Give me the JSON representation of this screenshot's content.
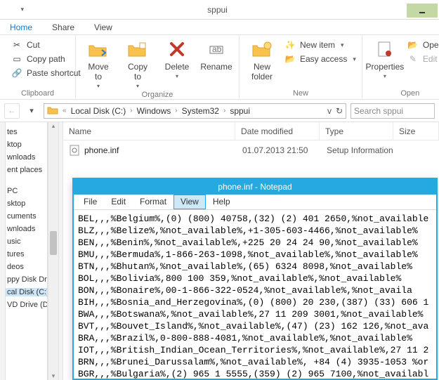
{
  "window": {
    "title": "sppui"
  },
  "tabs": {
    "home": "Home",
    "share": "Share",
    "view": "View"
  },
  "ribbon": {
    "clipboard": {
      "label": "Clipboard",
      "cut": "Cut",
      "copy_path": "Copy path",
      "paste_shortcut": "Paste shortcut"
    },
    "organize": {
      "label": "Organize",
      "move_to": "Move\nto",
      "copy_to": "Copy\nto",
      "delete": "Delete",
      "rename": "Rename"
    },
    "new": {
      "label": "New",
      "new_folder": "New\nfolder",
      "new_item": "New item",
      "easy_access": "Easy access"
    },
    "open": {
      "label": "Open",
      "properties": "Properties",
      "open": "Open",
      "edit": "Edit"
    }
  },
  "address": {
    "segs": [
      "Local Disk (C:)",
      "Windows",
      "System32",
      "sppui"
    ],
    "search_placeholder": "Search sppui"
  },
  "navpane": {
    "items": [
      "tes",
      "ktop",
      "wnloads",
      "ent places",
      "",
      "",
      "PC",
      "sktop",
      "cuments",
      "wnloads",
      "usic",
      "tures",
      "deos",
      "ppy Disk Dri",
      "cal Disk (C:)",
      "VD Drive (D:)"
    ],
    "selected_index": 14
  },
  "columns": {
    "name": "Name",
    "date": "Date modified",
    "type": "Type",
    "size": "Size"
  },
  "file": {
    "name": "phone.inf",
    "date": "01.07.2013 21:50",
    "type": "Setup Information"
  },
  "notepad": {
    "title": "phone.inf - Notepad",
    "menu": {
      "file": "File",
      "edit": "Edit",
      "format": "Format",
      "view": "View",
      "help": "Help"
    },
    "lines": [
      "BEL,,,%Belgium%,(0) (800) 40758,(32) (2) 401 2650,%not_available",
      "BLZ,,,%Belize%,%not_available%,+1-305-603-4466,%not_available%",
      "BEN,,,%Benin%,%not_available%,+225 20 24 24 90,%not_available%",
      "BMU,,,%Bermuda%,1-866-263-1098,%not_available%,%not_available%",
      "BTN,,,%Bhutan%,%not_available%,(65) 6324 8098,%not_available%",
      "BOL,,,%Bolivia%,800 100 359,%not_available%,%not_available%",
      "BON,,,%Bonaire%,00-1-866-322-0524,%not_available%,%not_availa",
      "BIH,,,%Bosnia_and_Herzegovina%,(0) (800) 20 230,(387) (33) 606 1",
      "BWA,,,%Botswana%,%not_available%,27 11 209 3001,%not_available%",
      "BVT,,,%Bouvet_Island%,%not_available%,(47) (23) 162 126,%not_ava",
      "BRA,,,%Brazil%,0-800-888-4081,%not_available%,%not_available%",
      "IOT,,,%British_Indian_Ocean_Territories%,%not_available%,27 11 2",
      "BRN,,,%Brunei_Darussalam%,%not_available%, +84 (4) 3935-1053 %or",
      "BGR,,,%Bulgaria%,(2) 965 1 5555,(359) (2) 965 7100,%not_availabl"
    ]
  }
}
